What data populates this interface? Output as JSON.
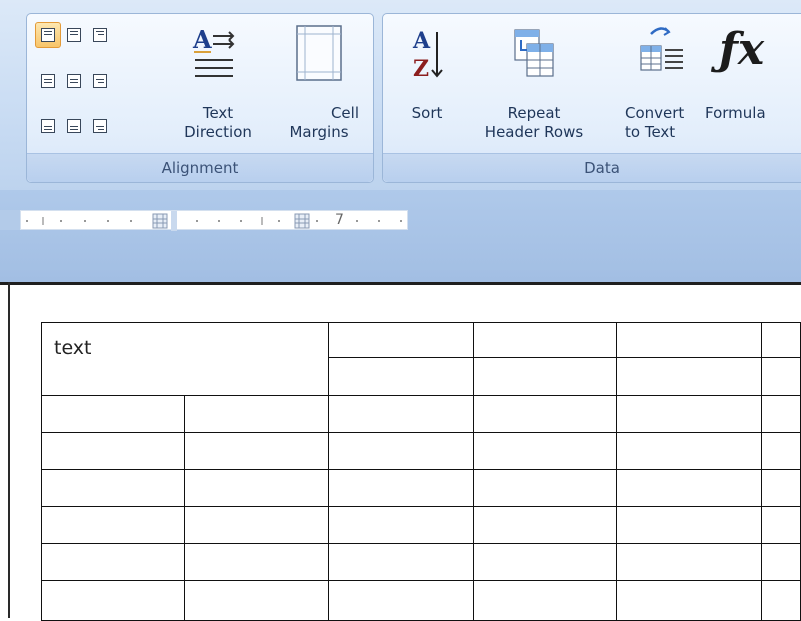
{
  "ribbon": {
    "alignment_group": {
      "label": "Alignment",
      "text_direction": {
        "line1": "Text",
        "line2": "Direction"
      },
      "cell_margins": {
        "line1": "Cell",
        "line2": "Margins"
      }
    },
    "data_group": {
      "label": "Data",
      "sort": "Sort",
      "repeat_header_rows": {
        "line1": "Repeat",
        "line2": "Header Rows"
      },
      "convert_to_text": {
        "line1": "Convert",
        "line2": "to Text"
      },
      "formula": "Formula"
    }
  },
  "ruler": {
    "number": "7"
  },
  "table": {
    "first_cell_text": "text"
  }
}
